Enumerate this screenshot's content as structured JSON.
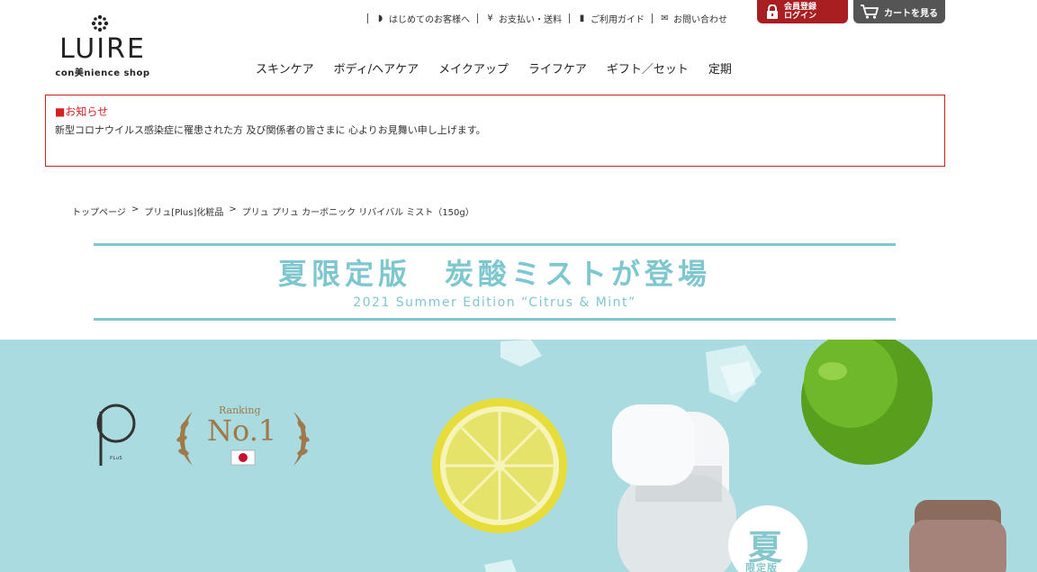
{
  "brand": {
    "logo_text": "LUIRE",
    "logo_sub": "con美nience shop"
  },
  "util_nav": [
    {
      "label": "はじめてのお客様へ",
      "icon": "beginner-mark-icon",
      "glyph": "◗"
    },
    {
      "label": "お支払い・送料",
      "icon": "yen-icon",
      "glyph": "¥"
    },
    {
      "label": "ご利用ガイド",
      "icon": "guide-book-icon",
      "glyph": "▮"
    },
    {
      "label": "お問い合わせ",
      "icon": "mail-icon",
      "glyph": "✉"
    }
  ],
  "header_buttons": {
    "member_line1": "会員登録",
    "member_line2": "ログイン",
    "cart": "カートを見る"
  },
  "main_nav": [
    "スキンケア",
    "ボディ/ヘアケア",
    "メイクアップ",
    "ライフケア",
    "ギフト／セット",
    "定期"
  ],
  "notice": {
    "title": "■お知らせ",
    "body": "新型コロナウイルス感染症に罹患された方 及び関係者の皆さまに 心よりお見舞い申し上げます。"
  },
  "breadcrumb": [
    "トップページ",
    "プリュ[Plus]化粧品",
    "プリュ プリュ カーボニック リバイバル ミスト（150g）"
  ],
  "breadcrumb_sep": ">",
  "campaign": {
    "title": "夏限定版　炭酸ミストが登場",
    "subtitle": "2021 Summer Edition “Citrus & Mint”"
  },
  "hero": {
    "ranking_label": "Ranking",
    "ranking_value": "No.1",
    "plus_brand": "PLuS",
    "badge_kanji": "夏",
    "badge_sub": "限定版"
  },
  "colors": {
    "brand_red": "#a81e21",
    "accent_teal": "#7fc7cf",
    "hero_bg": "#a9dbe0",
    "notice_border": "#d32020"
  }
}
